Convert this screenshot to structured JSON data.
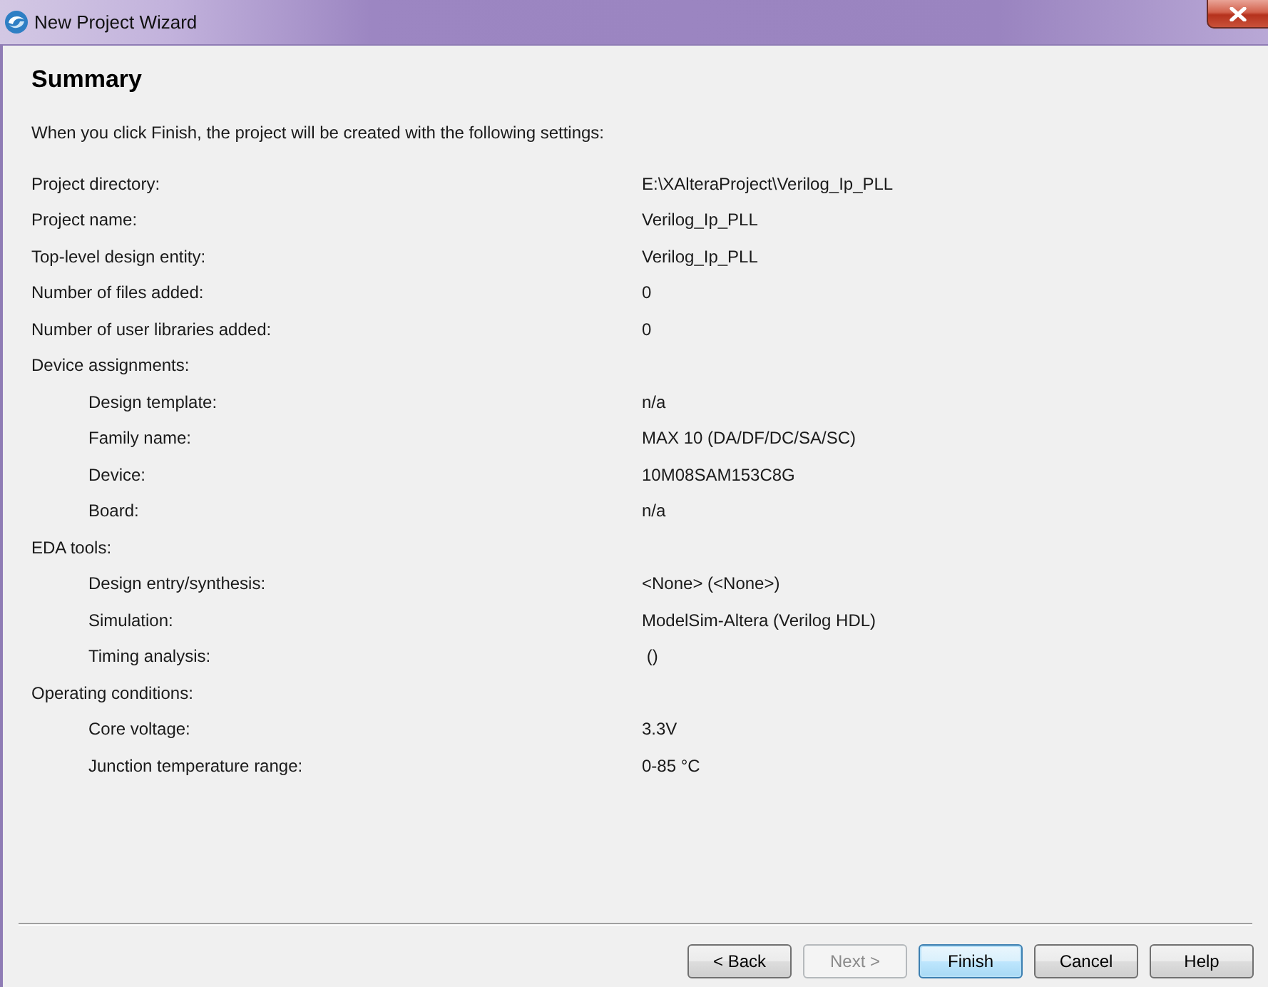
{
  "window": {
    "title": "New Project Wizard"
  },
  "page": {
    "heading": "Summary",
    "description": "When you click Finish, the project will be created with the following settings:"
  },
  "settings": [
    {
      "label": "Project directory:",
      "value": "E:\\XAlteraProject\\Verilog_Ip_PLL"
    },
    {
      "label": "Project name:",
      "value": "Verilog_Ip_PLL"
    },
    {
      "label": "Top-level design entity:",
      "value": "Verilog_Ip_PLL"
    },
    {
      "label": "Number of files added:",
      "value": "0"
    },
    {
      "label": "Number of user libraries added:",
      "value": "0"
    },
    {
      "label": "Device assignments:",
      "children": [
        {
          "label": "Design template:",
          "value": "n/a"
        },
        {
          "label": "Family name:",
          "value": "MAX 10 (DA/DF/DC/SA/SC)"
        },
        {
          "label": "Device:",
          "value": "10M08SAM153C8G"
        },
        {
          "label": "Board:",
          "value": "n/a"
        }
      ]
    },
    {
      "label": "EDA tools:",
      "children": [
        {
          "label": "Design entry/synthesis:",
          "value": "<None> (<None>)"
        },
        {
          "label": "Simulation:",
          "value": "ModelSim-Altera (Verilog HDL)"
        },
        {
          "label": "Timing analysis:",
          "value": " ()"
        }
      ]
    },
    {
      "label": "Operating conditions:",
      "children": [
        {
          "label": "Core voltage:",
          "value": "3.3V"
        },
        {
          "label": "Junction temperature range:",
          "value": "0-85 °C"
        }
      ]
    }
  ],
  "buttons": [
    {
      "label": "< Back",
      "disabled": false,
      "default": false
    },
    {
      "label": "Next >",
      "disabled": true,
      "default": false
    },
    {
      "label": "Finish",
      "disabled": false,
      "default": true
    },
    {
      "label": "Cancel",
      "disabled": false,
      "default": false
    },
    {
      "label": "Help",
      "disabled": false,
      "default": false
    }
  ]
}
